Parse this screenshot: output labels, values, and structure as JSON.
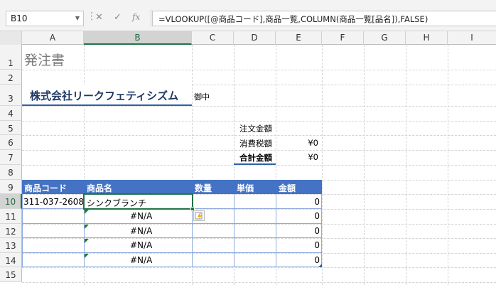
{
  "formula_bar": {
    "name_box": "B10",
    "cancel_glyph": "✕",
    "enter_glyph": "✓",
    "fx_glyph": "fx",
    "formula": "=VLOOKUP([@商品コード],商品一覧,COLUMN(商品一覧[品名]),FALSE)"
  },
  "columns": [
    "A",
    "B",
    "C",
    "D",
    "E",
    "F",
    "G",
    "H",
    "I"
  ],
  "rows": [
    "1",
    "2",
    "3",
    "4",
    "5",
    "6",
    "7",
    "8",
    "9",
    "10",
    "11",
    "12",
    "13",
    "14",
    "15"
  ],
  "sheet": {
    "title": "発注書",
    "company": "株式会社リークフェティシズム",
    "honorific": "御中",
    "summary": [
      {
        "label": "注文金額",
        "value": ""
      },
      {
        "label": "消費税額",
        "value": "¥0"
      },
      {
        "label": "合計金額",
        "value": "¥0"
      }
    ],
    "table_headers": [
      "商品コード",
      "商品名",
      "数量",
      "単価",
      "金額"
    ],
    "table_rows": [
      {
        "code": "311-037-2608",
        "name": "シンクブランチ",
        "amount": "0"
      },
      {
        "code": "",
        "name": "#N/A",
        "amount": "0"
      },
      {
        "code": "",
        "name": "#N/A",
        "amount": "0"
      },
      {
        "code": "",
        "name": "#N/A",
        "amount": "0"
      },
      {
        "code": "",
        "name": "#N/A",
        "amount": "0"
      }
    ]
  },
  "colors": {
    "header_fill": "#4472c4",
    "accent_underline": "#2e5fa8",
    "selection_green": "#217346",
    "error_triangle": "#1e7d33"
  }
}
